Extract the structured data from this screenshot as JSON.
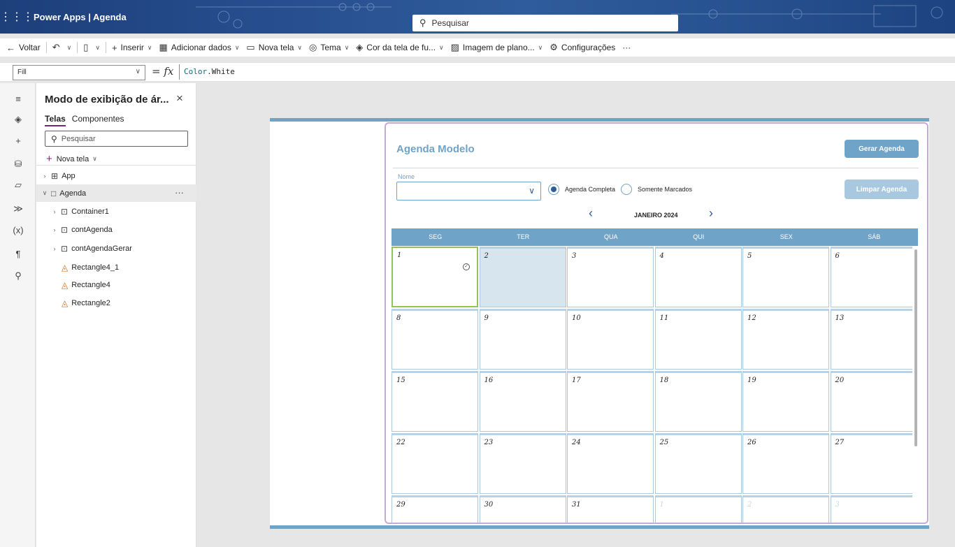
{
  "titlebar": {
    "app_title": "Power Apps | Agenda",
    "search_placeholder": "Pesquisar"
  },
  "commands": {
    "back": "Voltar",
    "insert": "Inserir",
    "add_data": "Adicionar dados",
    "new_screen": "Nova tela",
    "theme": "Tema",
    "screen_color": "Cor da tela de fu...",
    "background_image": "Imagem de plano...",
    "settings": "Configurações",
    "more": "···"
  },
  "formula": {
    "property": "Fill",
    "eq": "=",
    "fx": "fx",
    "obj": "Color",
    "member": ".White"
  },
  "tree": {
    "title": "Modo de exibição de ár...",
    "tabs": [
      "Telas",
      "Componentes"
    ],
    "search_placeholder": "Pesquisar",
    "new_screen": "Nova tela",
    "nodes": [
      "App",
      "Agenda",
      "Container1",
      "contAgenda",
      "contAgendaGerar",
      "Rectangle4_1",
      "Rectangle4",
      "Rectangle2"
    ],
    "more": "···"
  },
  "agenda": {
    "title": "Agenda Modelo",
    "gerar_label": "Gerar Agenda",
    "limpar_label": "Limpar Agenda",
    "nome_label": "Nome",
    "radio_complete": "Agenda Completa",
    "radio_marked": "Somente Marcados",
    "month": "JANEIRO 2024",
    "weekdays": [
      "SEG",
      "TER",
      "QUA",
      "QUI",
      "SEX",
      "SÁB"
    ],
    "days": [
      "1",
      "2",
      "3",
      "4",
      "5",
      "6",
      "8",
      "9",
      "10",
      "11",
      "12",
      "13",
      "15",
      "16",
      "17",
      "18",
      "19",
      "20",
      "22",
      "23",
      "24",
      "25",
      "26",
      "27",
      "29",
      "30",
      "31",
      "1",
      "2",
      "3"
    ]
  },
  "colors": {
    "accent": "#6fa3c7",
    "brand": "#742774",
    "today_border": "#92c353",
    "selected_fill": "#d7e5ef"
  }
}
